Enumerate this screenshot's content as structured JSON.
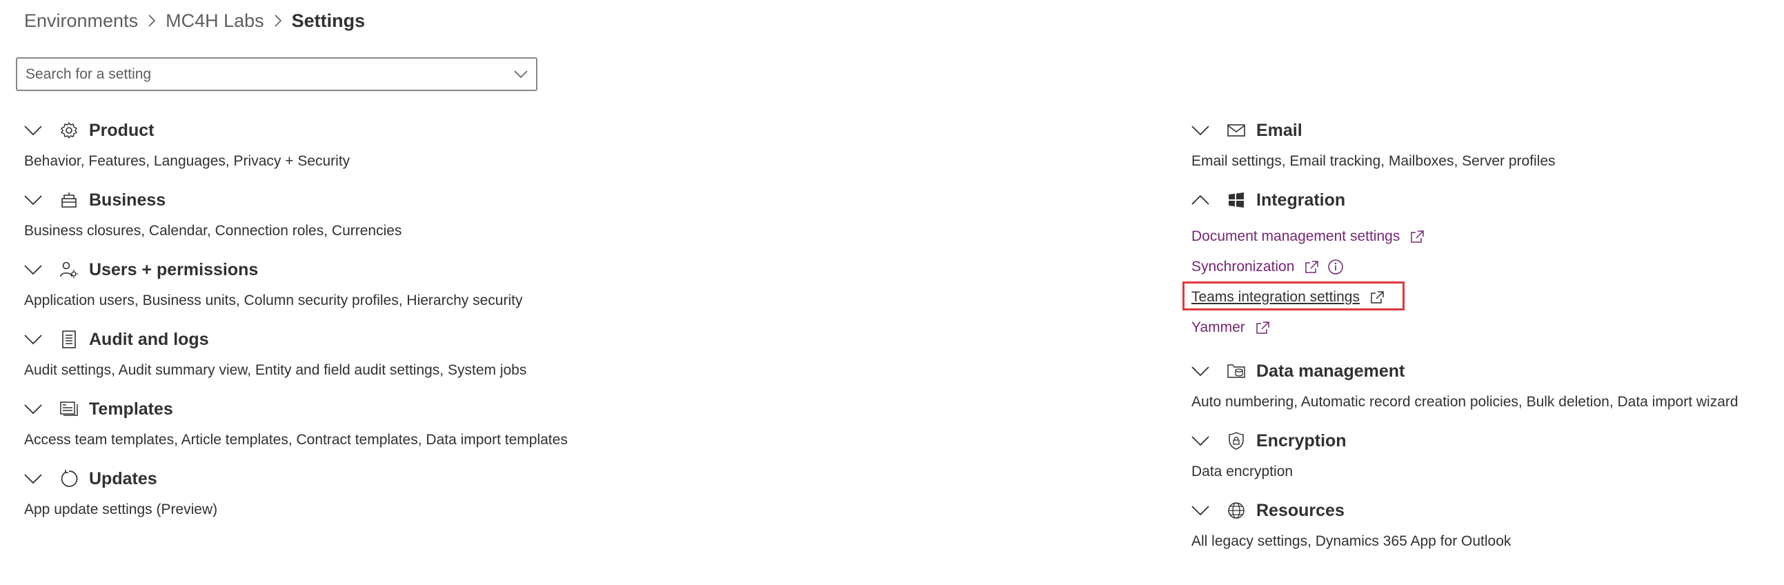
{
  "breadcrumb": {
    "items": [
      "Environments",
      "MC4H Labs",
      "Settings"
    ]
  },
  "search": {
    "placeholder": "Search for a setting"
  },
  "colors": {
    "link": "#742774",
    "highlight_border": "#e03a3a",
    "text": "#323130"
  },
  "left_sections": [
    {
      "title": "Product",
      "icon": "gear-icon",
      "expanded": false,
      "description": "Behavior, Features, Languages, Privacy + Security"
    },
    {
      "title": "Business",
      "icon": "business-icon",
      "expanded": false,
      "description": "Business closures, Calendar, Connection roles, Currencies"
    },
    {
      "title": "Users + permissions",
      "icon": "users-permissions-icon",
      "expanded": false,
      "description": "Application users, Business units, Column security profiles, Hierarchy security"
    },
    {
      "title": "Audit and logs",
      "icon": "audit-log-icon",
      "expanded": false,
      "description": "Audit settings, Audit summary view, Entity and field audit settings, System jobs"
    },
    {
      "title": "Templates",
      "icon": "templates-icon",
      "expanded": false,
      "description": "Access team templates, Article templates, Contract templates, Data import templates"
    },
    {
      "title": "Updates",
      "icon": "updates-icon",
      "expanded": false,
      "description": "App update settings (Preview)"
    }
  ],
  "right_sections": {
    "email": {
      "title": "Email",
      "icon": "mail-icon",
      "expanded": false,
      "description": "Email settings, Email tracking, Mailboxes, Server profiles"
    },
    "integration": {
      "title": "Integration",
      "icon": "windows-icon",
      "expanded": true,
      "links": [
        {
          "label": "Document management settings",
          "external": true,
          "info": false,
          "highlighted": false
        },
        {
          "label": "Synchronization",
          "external": true,
          "info": true,
          "highlighted": false
        },
        {
          "label": "Teams integration settings",
          "external": true,
          "info": false,
          "highlighted": true
        },
        {
          "label": "Yammer",
          "external": true,
          "info": false,
          "highlighted": false
        }
      ]
    },
    "data_management": {
      "title": "Data management",
      "icon": "data-management-icon",
      "expanded": false,
      "description": "Auto numbering, Automatic record creation policies, Bulk deletion, Data import wizard"
    },
    "encryption": {
      "title": "Encryption",
      "icon": "shield-lock-icon",
      "expanded": false,
      "description": "Data encryption"
    },
    "resources": {
      "title": "Resources",
      "icon": "globe-icon",
      "expanded": false,
      "description": "All legacy settings, Dynamics 365 App for Outlook"
    }
  }
}
